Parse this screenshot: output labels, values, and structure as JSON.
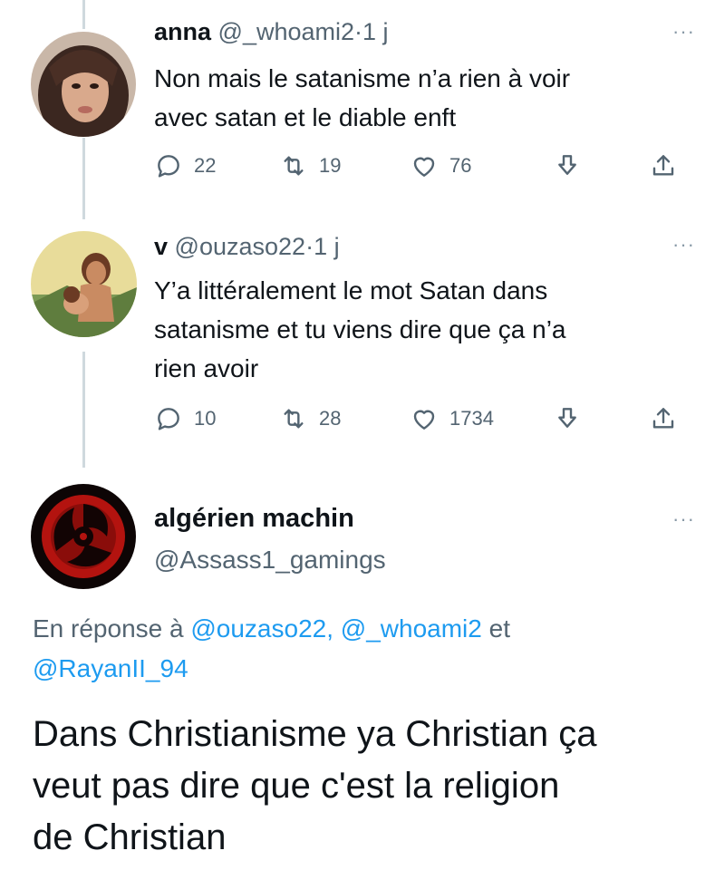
{
  "tweets": [
    {
      "name": "anna",
      "handle": "@_whoami2",
      "sep": "·",
      "time": "1 j",
      "text_lines": [
        "Non mais le satanisme n’a rien à voir",
        "avec satan et le diable enft"
      ],
      "replies": "22",
      "retweets": "19",
      "likes": "76",
      "more": "···"
    },
    {
      "name": "v",
      "handle": "@ouzaso22",
      "sep": "·",
      "time": "1 j",
      "text_lines": [
        "Y’a littéralement le mot Satan dans",
        "satanisme et tu viens dire que ça n’a",
        "rien avoir"
      ],
      "replies": "10",
      "retweets": "28",
      "likes": "1734",
      "more": "···"
    }
  ],
  "main_tweet": {
    "name": "algérien machin",
    "handle": "@Assass1_gamings",
    "more": "···",
    "reply_prefix": "En réponse à",
    "reply_mentions": [
      "@ouzaso22,",
      "@_whoami2",
      "et",
      "@RayanII_94"
    ],
    "text_lines": [
      "Dans Christianisme ya Christian ça",
      "veut pas dire que c'est la religion",
      "de Christian"
    ]
  },
  "colors": {
    "accent": "#1d9bf0",
    "secondary_text": "#536471",
    "thread_line": "#cfd9de"
  },
  "icons": [
    "reply-icon",
    "retweet-icon",
    "like-icon",
    "download-icon",
    "share-icon",
    "more-icon"
  ]
}
